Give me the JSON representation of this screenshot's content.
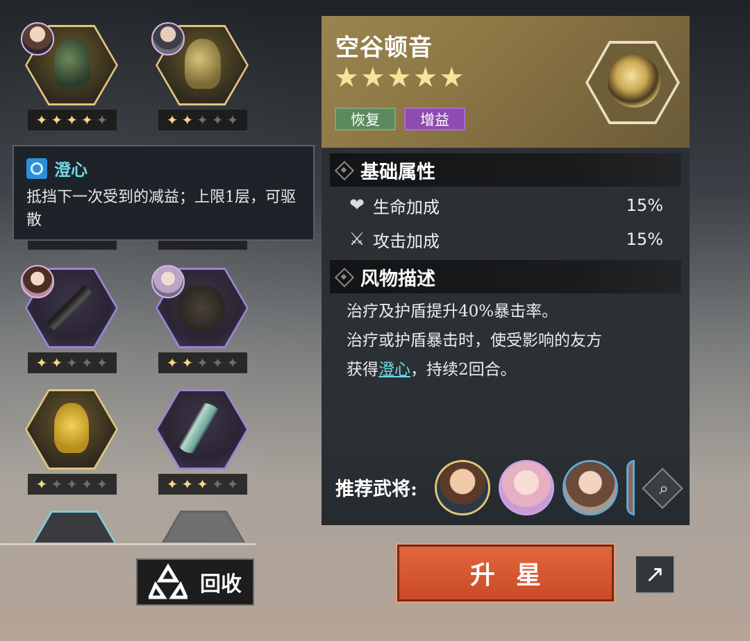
{
  "relic_grid": {
    "items": [
      {
        "rarity": "gold",
        "art": "bronze",
        "avatar": "a1",
        "stars_on": 4,
        "stars_total": 5
      },
      {
        "rarity": "gold",
        "art": "goldart",
        "avatar": "a2",
        "stars_on": 2,
        "stars_total": 5
      },
      {
        "rarity": "purple",
        "art": "whisk",
        "avatar": "a3",
        "stars_on": 2,
        "stars_total": 5
      },
      {
        "rarity": "purple",
        "art": "pot",
        "avatar": "a4",
        "stars_on": 2,
        "stars_total": 5
      },
      {
        "rarity": "gold",
        "art": "jue",
        "avatar": null,
        "stars_on": 1,
        "stars_total": 5
      },
      {
        "rarity": "purple",
        "art": "ruyi",
        "avatar": null,
        "stars_on": 3,
        "stars_total": 5
      }
    ],
    "recycle_label": "回收"
  },
  "tooltip": {
    "icon": "buff-icon",
    "title": "澄心",
    "text": "抵挡下一次受到的减益；上限1层，可驱散"
  },
  "detail": {
    "name": "空谷顿音",
    "stars": "★★★★★",
    "star_count": 5,
    "tags": [
      "恢复",
      "增益"
    ],
    "base_attr_title": "基础属性",
    "stats": [
      {
        "icon": "heart-icon",
        "label": "生命加成",
        "value": "15%"
      },
      {
        "icon": "swords-icon",
        "label": "攻击加成",
        "value": "15%"
      }
    ],
    "desc_title": "风物描述",
    "desc_line1": "治疗及护盾提升40%暴击率。",
    "desc_line2": "治疗或护盾暴击时，使受影响的友方",
    "desc_line3_pre": "获得",
    "desc_line3_kw": "澄心",
    "desc_line3_post": "，持续2回合。",
    "recommend_label": "推荐武将:"
  },
  "actions": {
    "upgrade_label": "升星",
    "share_icon": "external-link-icon"
  },
  "colors": {
    "gold_frame": "#e2c57a",
    "purple_frame": "#9a84d6",
    "keyword": "#71d8e6",
    "upgrade": "#d85a32"
  }
}
